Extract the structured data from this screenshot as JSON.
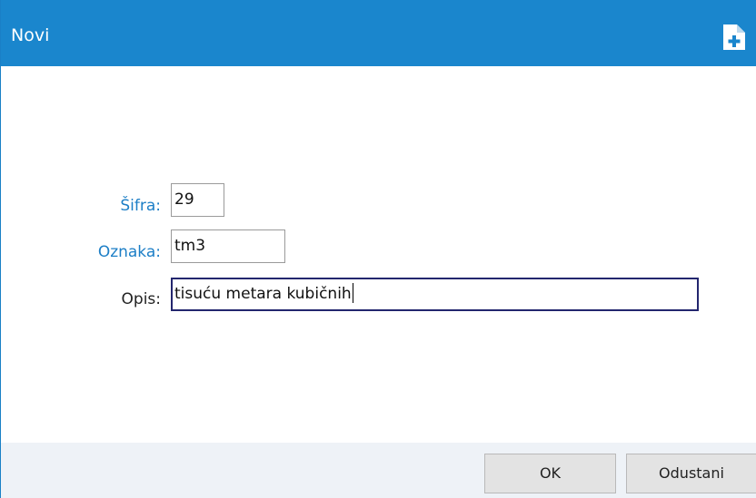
{
  "dialog": {
    "title": "Novi",
    "title_icon": "new-document-plus-icon",
    "accent_color": "#1a86cd"
  },
  "form": {
    "sifra": {
      "label": "Šifra:",
      "value": "29"
    },
    "oznaka": {
      "label": "Oznaka:",
      "value": "tm3"
    },
    "opis": {
      "label": "Opis:",
      "value": "tisuću metara kubičnih"
    }
  },
  "buttons": {
    "ok_label": "OK",
    "cancel_label": "Odustani"
  }
}
